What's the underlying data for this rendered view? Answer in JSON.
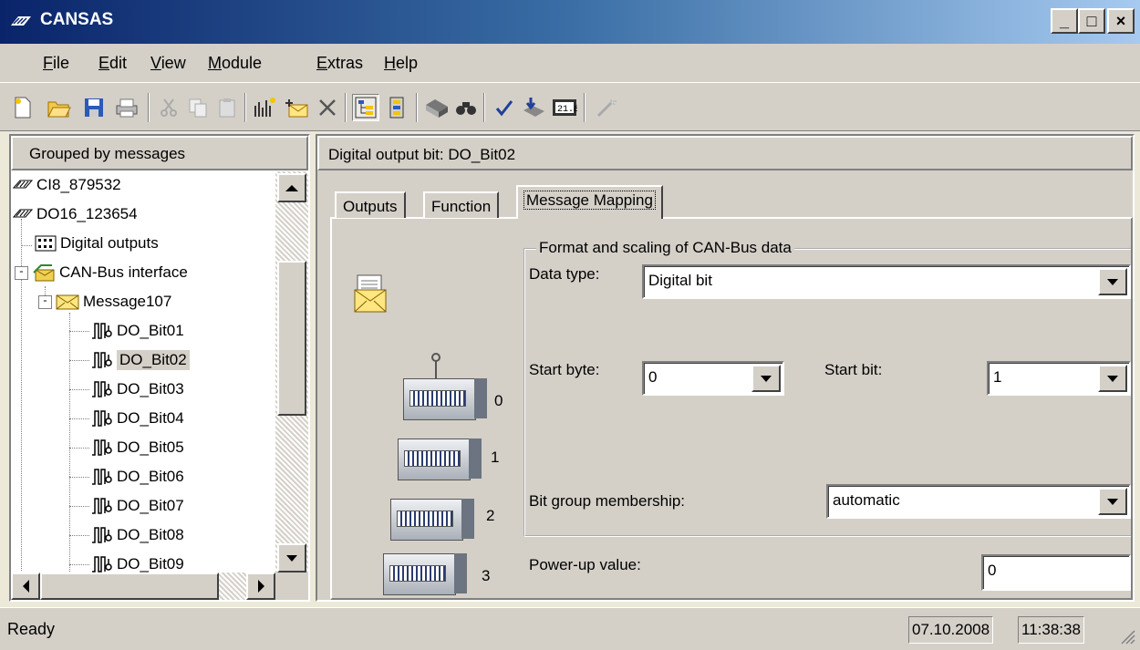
{
  "window": {
    "title": "CANSAS",
    "minimize": "_",
    "maximize": "□",
    "close": "×"
  },
  "menu": {
    "items": [
      "File",
      "Edit",
      "View",
      "Module",
      "Extras",
      "Help"
    ]
  },
  "toolbar": {
    "icons": [
      "new-icon",
      "open-icon",
      "save-icon",
      "print-icon",
      "cut-icon",
      "copy-icon",
      "paste-icon",
      "add-module-icon",
      "add-message-icon",
      "delete-icon",
      "tree-view-icon",
      "list-view-icon",
      "device-icon",
      "search-icon",
      "check-icon",
      "download-icon",
      "display-icon",
      "wand-icon"
    ]
  },
  "left": {
    "header": "Grouped by messages",
    "tree": [
      {
        "label": "CI8_879532",
        "level": 0,
        "icon": "module-icon"
      },
      {
        "label": "DO16_123654",
        "level": 0,
        "icon": "module-icon"
      },
      {
        "label": "Digital outputs",
        "level": 1,
        "icon": "io-grid-icon"
      },
      {
        "label": "CAN-Bus interface",
        "level": 1,
        "icon": "can-interface-icon",
        "expander": "-"
      },
      {
        "label": "Message107",
        "level": 2,
        "icon": "message-icon",
        "expander": "-"
      },
      {
        "label": "DO_Bit01",
        "level": 3,
        "icon": "pulse-icon"
      },
      {
        "label": "DO_Bit02",
        "level": 3,
        "icon": "pulse-icon",
        "selected": true
      },
      {
        "label": "DO_Bit03",
        "level": 3,
        "icon": "pulse-icon"
      },
      {
        "label": "DO_Bit04",
        "level": 3,
        "icon": "pulse-icon"
      },
      {
        "label": "DO_Bit05",
        "level": 3,
        "icon": "pulse-icon"
      },
      {
        "label": "DO_Bit06",
        "level": 3,
        "icon": "pulse-icon"
      },
      {
        "label": "DO_Bit07",
        "level": 3,
        "icon": "pulse-icon"
      },
      {
        "label": "DO_Bit08",
        "level": 3,
        "icon": "pulse-icon"
      },
      {
        "label": "DO_Bit09",
        "level": 3,
        "icon": "pulse-icon"
      }
    ]
  },
  "right": {
    "header": "Digital output bit: DO_Bit02",
    "tabs": [
      "Outputs",
      "Function",
      "Message Mapping"
    ],
    "active_tab": "Message Mapping",
    "group_title": "Format and scaling of CAN-Bus data",
    "data_type_label": "Data type:",
    "data_type_value": "Digital bit",
    "start_byte_label": "Start byte:",
    "start_byte_value": "0",
    "start_bit_label": "Start bit:",
    "start_bit_value": "1",
    "bit_group_label": "Bit group membership:",
    "bit_group_value": "automatic",
    "power_up_label": "Power-up value:",
    "power_up_value": "0",
    "byte_numbers": [
      "0",
      "1",
      "2",
      "3"
    ]
  },
  "status": {
    "text": "Ready",
    "date": "07.10.2008",
    "time": "11:38:38"
  }
}
